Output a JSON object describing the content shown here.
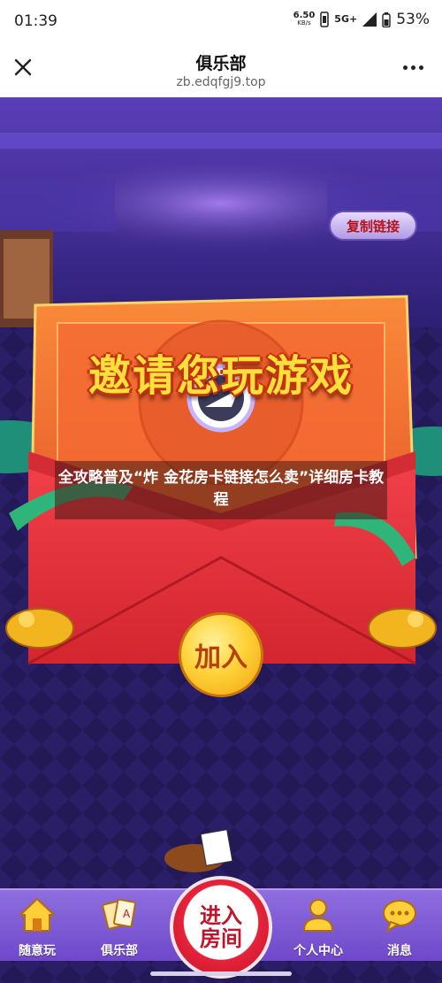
{
  "status_bar": {
    "time": "01:39",
    "speed_value": "6.50",
    "speed_unit": "KB/s",
    "network": "5G+",
    "battery": "53%"
  },
  "browser": {
    "title": "俱乐部",
    "url": "zb.edqfgj9.top"
  },
  "game": {
    "copy_link_label": "复制链接",
    "banner_text": "邀请您玩游戏",
    "caption": "全攻略普及“炸 金花房卡链接怎么卖”详细房卡教程",
    "join_label": "加入",
    "enter_room_label": "进入房间"
  },
  "tabs": [
    {
      "label": "随意玩",
      "icon": "home-icon"
    },
    {
      "label": "俱乐部",
      "icon": "cards-icon"
    },
    {
      "label": "个人中心",
      "icon": "user-icon"
    },
    {
      "label": "消息",
      "icon": "chat-icon"
    }
  ],
  "colors": {
    "banner_yellow": "#ffdf3b",
    "envelope_red": "#e8363e",
    "tab_purple": "#7a55d2",
    "enter_red": "#c2132a"
  }
}
